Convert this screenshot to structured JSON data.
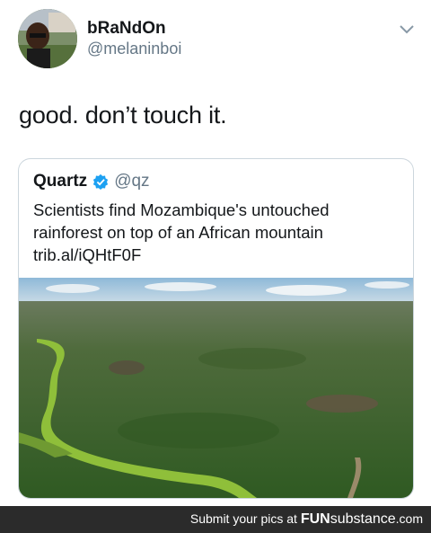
{
  "tweet": {
    "display_name": "bRaNdOn",
    "handle": "@melaninboi",
    "text": "good. don’t touch it."
  },
  "quoted_tweet": {
    "display_name": "Quartz",
    "handle": "@qz",
    "lines": [
      "Scientists find Mozambique's untouched",
      "rainforest on top of an African mountain",
      "trib.al/iQHtF0F"
    ],
    "verified": true
  },
  "footer": {
    "prefix": "Submit your pics at",
    "brand_fun": "FUN",
    "brand_sub": "substance",
    "brand_tld": ".com"
  },
  "icons": {
    "verified": "verified-badge-icon",
    "menu": "chevron-down-icon"
  },
  "colors": {
    "verified_blue": "#1da1f2",
    "handle_gray": "#657786",
    "footer_bg": "#2b2b2b"
  }
}
